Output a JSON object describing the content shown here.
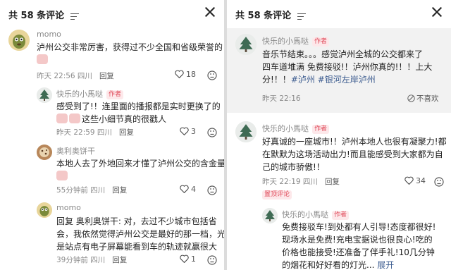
{
  "left": {
    "header": {
      "title": "共 58 条评论"
    },
    "comments": [
      {
        "user": "momo",
        "lines": [
          "泸州公交非常厉害，获得过不少全国和省级荣誉的"
        ],
        "time": "昨天 22:56 四川",
        "reply": "回复",
        "likes": "18"
      },
      {
        "user": "快乐的小馬哒",
        "tag": "作者",
        "lines": [
          "感受到了!！连里面的播报都是实时更换了的",
          "这些小细节真的很戳人"
        ],
        "time": "昨天 22:59 四川",
        "reply": "回复",
        "likes": "3"
      },
      {
        "user": "奥利奥饼干",
        "lines": [
          "本地人去了外地回来才懂了泸州公交的含金量"
        ],
        "time": "55分钟前 四川",
        "reply": "回复",
        "likes": "4"
      },
      {
        "user": "momo",
        "lines": [
          "回复 奥利奥饼干: 对，去过不少城市包括省",
          "会，我依然觉得泸州公交是最好的那一档，光",
          "是站点有电子屏幕能看到车的轨迹就赢很大"
        ],
        "reply_to": "回复 奥利奥饼干:",
        "time": "39分钟前 四川",
        "reply": "回复",
        "likes": "1"
      }
    ]
  },
  "right": {
    "header": {
      "title": "共 58 条评论"
    },
    "comments": [
      {
        "user": "快乐的小馬哒",
        "tag": "作者",
        "lines": [
          "音乐节结束。。。感觉泸州全城的公交都来了",
          "四车道堆满 免费接驳!！泸州你真的!！！上大",
          "分!！！"
        ],
        "hashtags": "#泸州 #银河左岸泸州",
        "time": "昨天 22:16",
        "dislike": "不喜欢"
      },
      {
        "user": "快乐的小馬哒",
        "tag": "作者",
        "lines": [
          "好真诚的一座城市!！泸州本地人也很有凝聚力!都",
          "在默默为这场活动出力!而且能感受到大家都为自",
          "己的城市骄傲!！"
        ],
        "time": "昨天 22:19 四川",
        "reply": "回复",
        "likes": "34",
        "pinned": "置顶评论"
      },
      {
        "user": "快乐的小馬哒",
        "tag": "作者",
        "lines": [
          "免费接驳车!到处都有人引导!态度都很好!",
          "现场水是免费!充电宝据说也很良心!吃的",
          "价格也能接受!还准备了伴手礼!10几分钟",
          "的烟花和好好看的灯光..."
        ],
        "expand": "展开"
      }
    ]
  },
  "colors": {
    "author_tag": "#e04a5a",
    "author_tag_bg": "#fde8ea",
    "hashtag": "#3b5b8f",
    "highlight_bg": "#f2f2f2"
  },
  "icons": [
    "filter-icon",
    "close-icon",
    "heart-icon",
    "dislike-icon",
    "momo-avatar",
    "tree-avatar",
    "cookie-avatar",
    "emoji-sticker"
  ]
}
